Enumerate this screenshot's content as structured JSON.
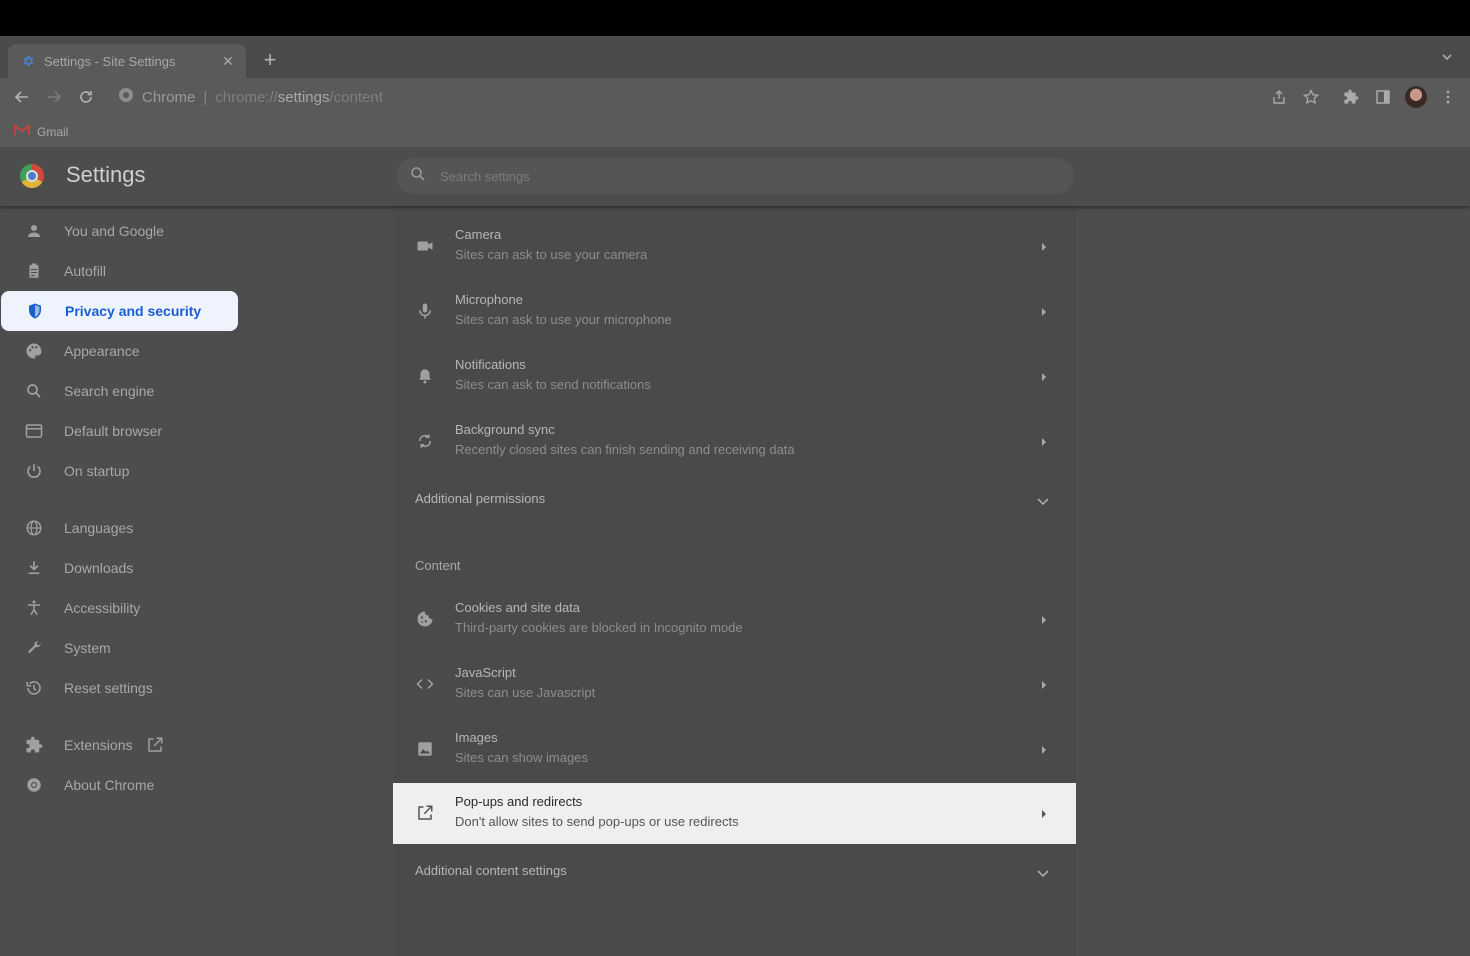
{
  "browser": {
    "tab_title": "Settings - Site Settings",
    "new_tab": "+",
    "url_site": "Chrome",
    "url_scheme": "chrome://",
    "url_host": "settings",
    "url_path": "/content",
    "bookmark_gmail": "Gmail"
  },
  "header": {
    "title": "Settings",
    "search_placeholder": "Search settings"
  },
  "sidebar": {
    "items": [
      {
        "label": "You and Google",
        "icon": "person-icon"
      },
      {
        "label": "Autofill",
        "icon": "clipboard-icon"
      },
      {
        "label": "Privacy and security",
        "icon": "shield-icon",
        "active": true
      },
      {
        "label": "Appearance",
        "icon": "palette-icon"
      },
      {
        "label": "Search engine",
        "icon": "search-icon"
      },
      {
        "label": "Default browser",
        "icon": "browser-window-icon"
      },
      {
        "label": "On startup",
        "icon": "power-icon"
      },
      {
        "label": "Languages",
        "icon": "globe-icon"
      },
      {
        "label": "Downloads",
        "icon": "download-icon"
      },
      {
        "label": "Accessibility",
        "icon": "accessibility-icon"
      },
      {
        "label": "System",
        "icon": "wrench-icon"
      },
      {
        "label": "Reset settings",
        "icon": "history-icon"
      },
      {
        "label": "Extensions",
        "icon": "puzzle-icon"
      },
      {
        "label": "About Chrome",
        "icon": "chrome-icon"
      }
    ]
  },
  "permissions": [
    {
      "title": "Camera",
      "subtitle": "Sites can ask to use your camera",
      "icon": "camera-icon"
    },
    {
      "title": "Microphone",
      "subtitle": "Sites can ask to use your microphone",
      "icon": "microphone-icon"
    },
    {
      "title": "Notifications",
      "subtitle": "Sites can ask to send notifications",
      "icon": "bell-icon"
    },
    {
      "title": "Background sync",
      "subtitle": "Recently closed sites can finish sending and receiving data",
      "icon": "sync-icon"
    }
  ],
  "additional_permissions": "Additional permissions",
  "content_section": "Content",
  "content_items": [
    {
      "title": "Cookies and site data",
      "subtitle": "Third-party cookies are blocked in Incognito mode",
      "icon": "cookie-icon"
    },
    {
      "title": "JavaScript",
      "subtitle": "Sites can use Javascript",
      "icon": "code-icon"
    },
    {
      "title": "Images",
      "subtitle": "Sites can show images",
      "icon": "image-icon"
    },
    {
      "title": "Pop-ups and redirects",
      "subtitle": "Don't allow sites to send pop-ups or use redirects",
      "icon": "open-external-icon",
      "highlighted": true
    }
  ],
  "additional_content": "Additional content settings",
  "colors": {
    "active_bg": "#eef3fd",
    "active_text": "#1a5fd1",
    "highlight_row": "#efefef"
  }
}
